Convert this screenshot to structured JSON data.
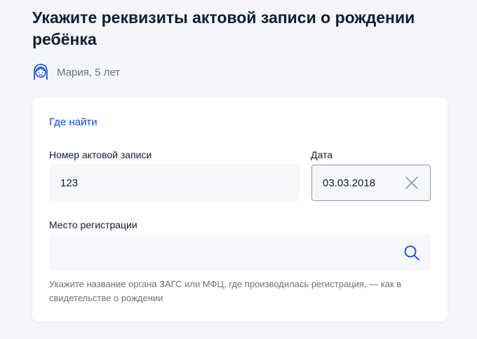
{
  "page": {
    "title": "Укажите реквизиты актовой записи о рождении ребёнка"
  },
  "child": {
    "avatar_icon": "girl-avatar-icon",
    "name": "Мария, 5 лет"
  },
  "form": {
    "where_link": "Где найти",
    "record_number": {
      "label": "Номер актовой записи",
      "value": "123"
    },
    "date": {
      "label": "Дата",
      "value": "03.03.2018",
      "clear_icon": "close-icon"
    },
    "registration_place": {
      "label": "Место регистрации",
      "value": "",
      "search_icon": "search-icon"
    },
    "hint": "Укажите название органа ЗАГС или МФЦ, где производилась регистрация, — как в свидетельстве о рождении"
  },
  "colors": {
    "background": "#f4f6fa",
    "card": "#ffffff",
    "link": "#0d4cd3",
    "text": "#0b1f33",
    "muted": "#66727f",
    "input_bg": "#f5f7fa",
    "icon_accent": "#0d4cd3"
  }
}
